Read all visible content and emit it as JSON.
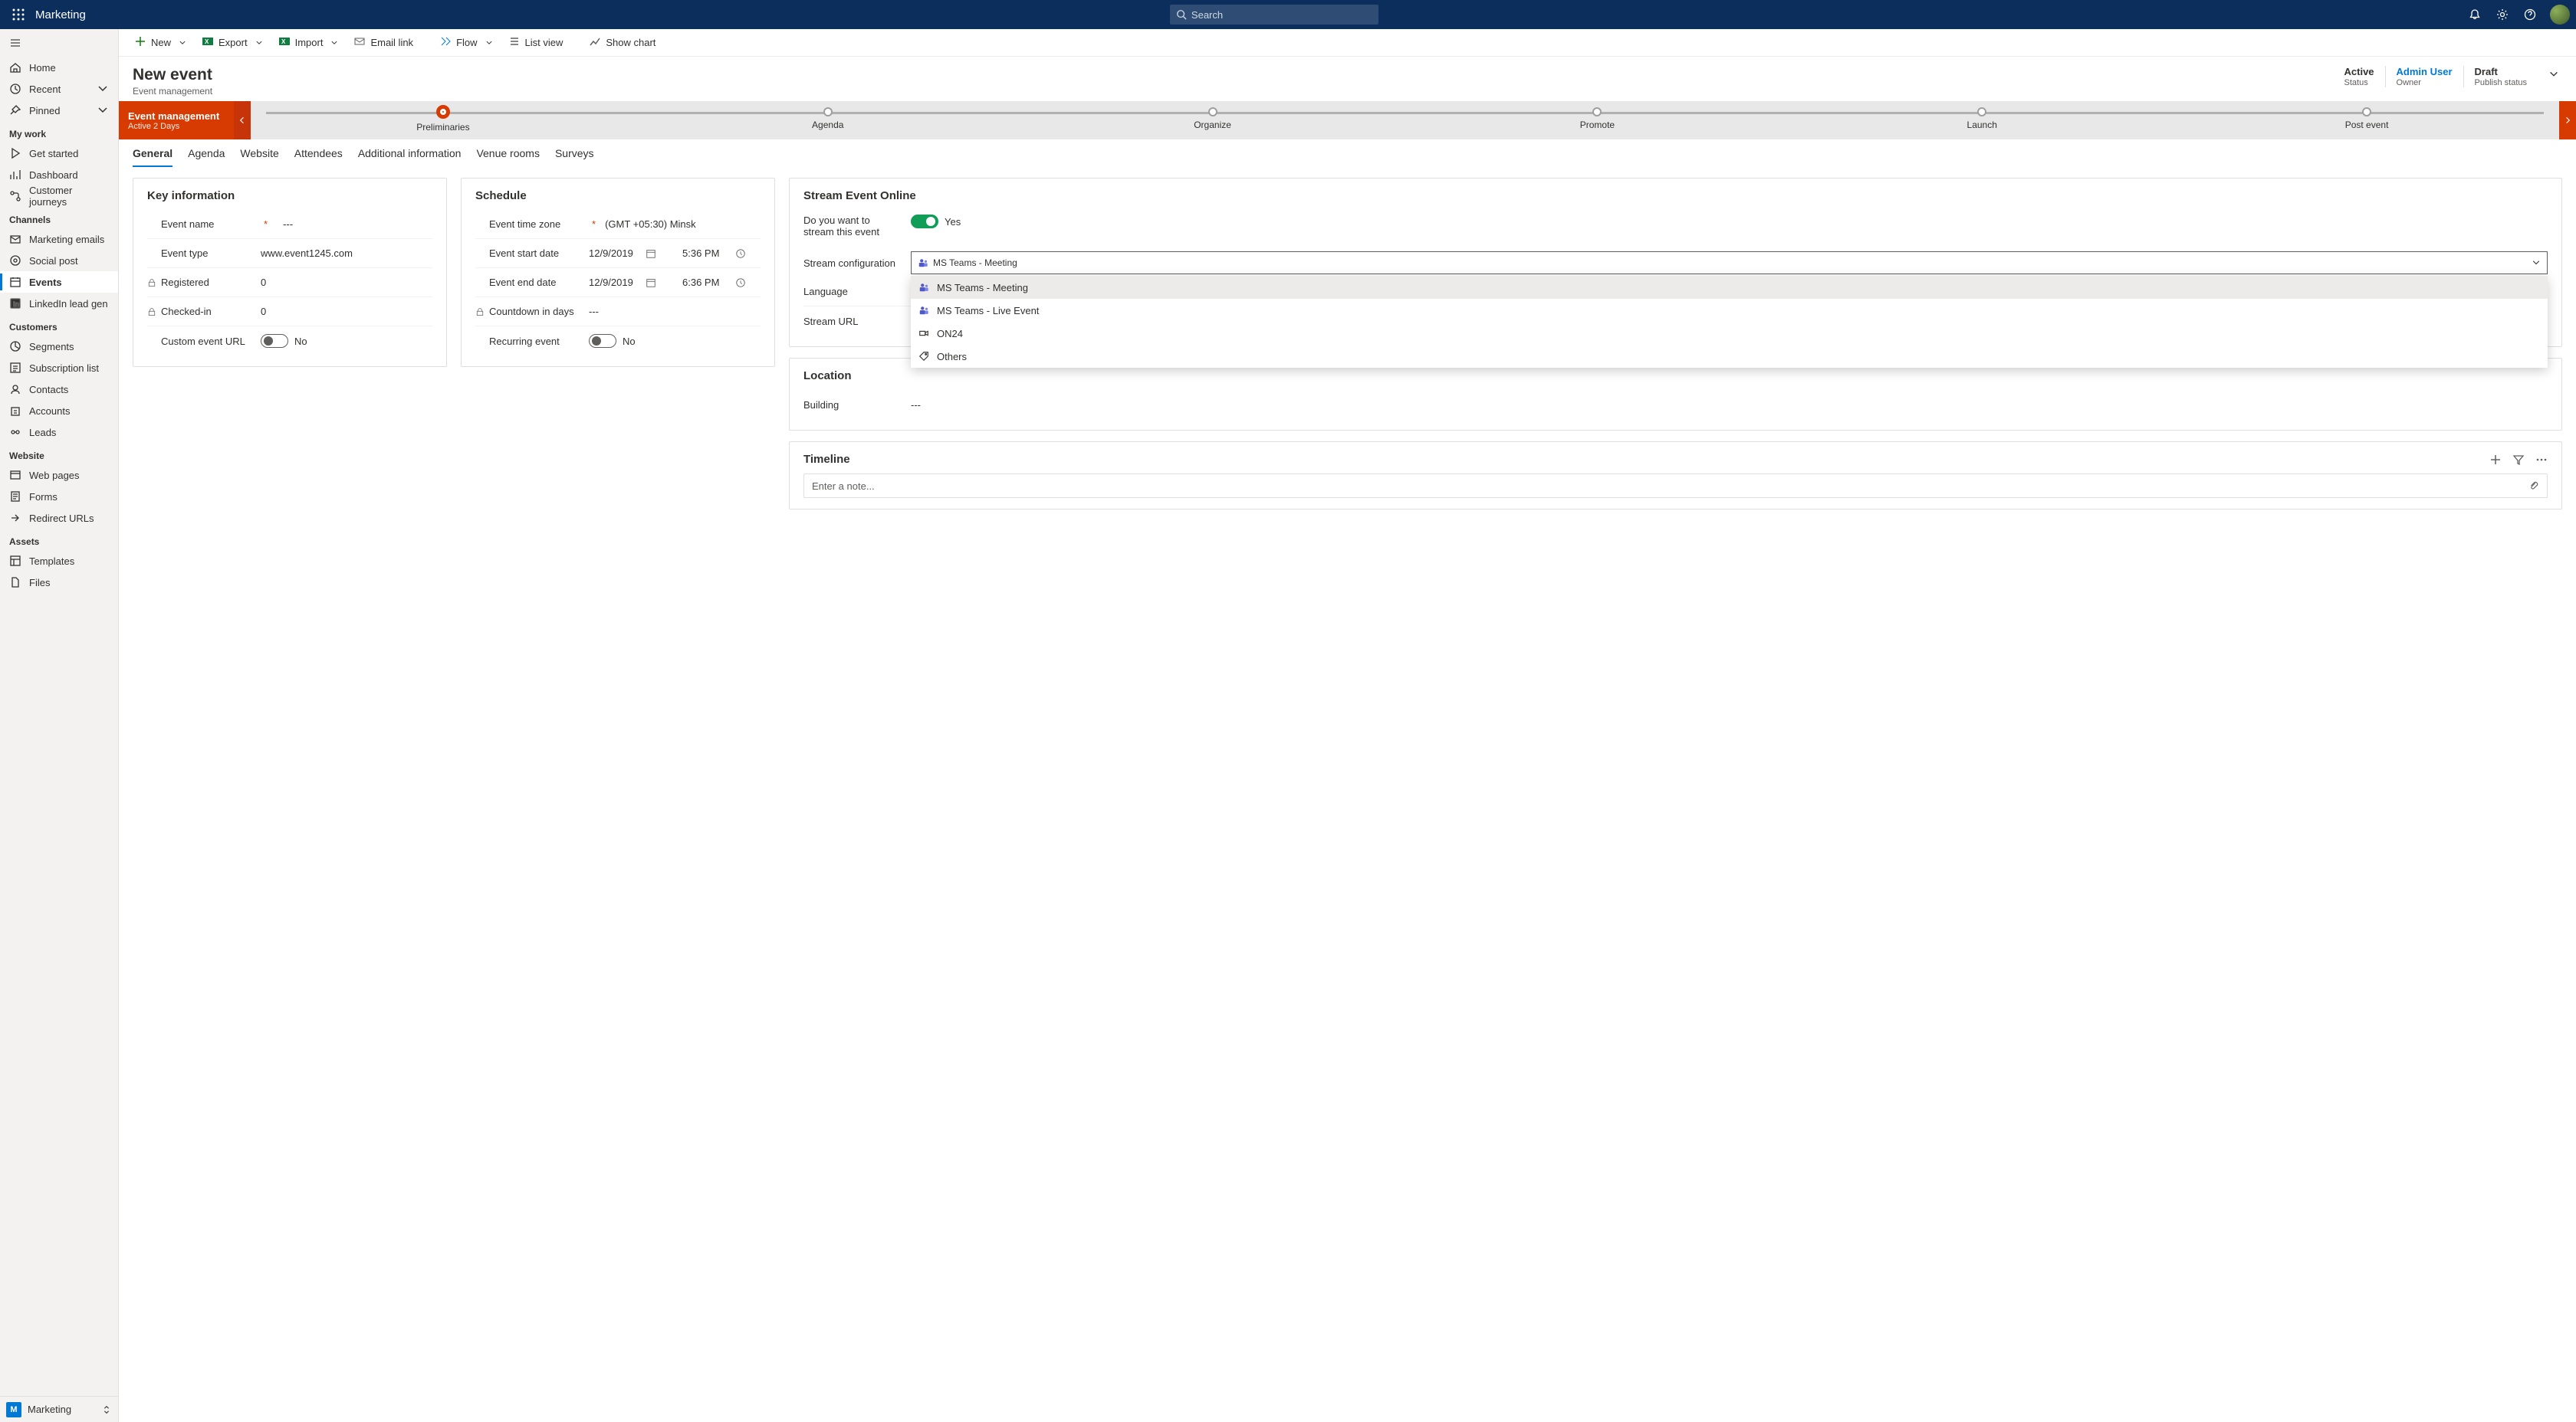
{
  "appName": "Marketing",
  "search": {
    "placeholder": "Search"
  },
  "sidebar": {
    "top": [
      {
        "label": "Home",
        "icon": "home"
      },
      {
        "label": "Recent",
        "icon": "clock",
        "chevron": true
      },
      {
        "label": "Pinned",
        "icon": "pin",
        "chevron": true
      }
    ],
    "groups": [
      {
        "title": "My work",
        "items": [
          {
            "label": "Get started",
            "icon": "play"
          },
          {
            "label": "Dashboard",
            "icon": "chart"
          },
          {
            "label": "Customer journeys",
            "icon": "journey"
          }
        ]
      },
      {
        "title": "Channels",
        "items": [
          {
            "label": "Marketing emails",
            "icon": "mail"
          },
          {
            "label": "Social post",
            "icon": "social"
          },
          {
            "label": "Events",
            "icon": "calendar",
            "active": true
          },
          {
            "label": "LinkedIn lead gen",
            "icon": "linkedin"
          }
        ]
      },
      {
        "title": "Customers",
        "items": [
          {
            "label": "Segments",
            "icon": "segments"
          },
          {
            "label": "Subscription list",
            "icon": "sublist"
          },
          {
            "label": "Contacts",
            "icon": "contact"
          },
          {
            "label": "Accounts",
            "icon": "accounts"
          },
          {
            "label": "Leads",
            "icon": "leads"
          }
        ]
      },
      {
        "title": "Website",
        "items": [
          {
            "label": "Web pages",
            "icon": "webpage"
          },
          {
            "label": "Forms",
            "icon": "forms"
          },
          {
            "label": "Redirect URLs",
            "icon": "redirect"
          }
        ]
      },
      {
        "title": "Assets",
        "items": [
          {
            "label": "Templates",
            "icon": "templates"
          },
          {
            "label": "Files",
            "icon": "files"
          }
        ]
      }
    ],
    "footer": {
      "badge": "M",
      "label": "Marketing"
    }
  },
  "commands": [
    {
      "label": "New",
      "icon": "plus",
      "split": true,
      "color": "#107c10"
    },
    {
      "label": "Export",
      "icon": "export",
      "split": true
    },
    {
      "label": "Import",
      "icon": "import",
      "split": true
    },
    {
      "label": "Email link",
      "icon": "emaillink"
    },
    {
      "label": "Flow",
      "icon": "flow",
      "split": true
    },
    {
      "label": "List view",
      "icon": "listview"
    },
    {
      "label": "Show chart",
      "icon": "showchart"
    }
  ],
  "page": {
    "title": "New event",
    "subtitle": "Event management",
    "headerFields": [
      {
        "value": "Active",
        "label": "Status"
      },
      {
        "value": "Admin User",
        "label": "Owner",
        "link": true
      },
      {
        "value": "Draft",
        "label": "Publish status"
      }
    ]
  },
  "process": {
    "currentTitle": "Event management",
    "currentSub": "Active 2 Days",
    "stages": [
      "Preliminaries",
      "Agenda",
      "Organize",
      "Promote",
      "Launch",
      "Post event"
    ],
    "activeIndex": 0
  },
  "tabs": [
    "General",
    "Agenda",
    "Website",
    "Attendees",
    "Additional information",
    "Venue rooms",
    "Surveys"
  ],
  "activeTab": 0,
  "keyInfo": {
    "title": "Key information",
    "fields": {
      "eventNameLabel": "Event name",
      "eventNameValue": "---",
      "eventTypeLabel": "Event type",
      "eventTypeValue": "www.event1245.com",
      "registeredLabel": "Registered",
      "registeredValue": "0",
      "checkedInLabel": "Checked-in",
      "checkedInValue": "0",
      "customUrlLabel": "Custom event URL",
      "customUrlValue": "No"
    }
  },
  "schedule": {
    "title": "Schedule",
    "fields": {
      "tzLabel": "Event time zone",
      "tzValue": "(GMT +05:30) Minsk",
      "startLabel": "Event start date",
      "startDate": "12/9/2019",
      "startTime": "5:36 PM",
      "endLabel": "Event end date",
      "endDate": "12/9/2019",
      "endTime": "6:36 PM",
      "countdownLabel": "Countdown in days",
      "countdownValue": "---",
      "recurringLabel": "Recurring event",
      "recurringValue": "No"
    }
  },
  "stream": {
    "title": "Stream Event Online",
    "questionText": "Do you want to stream this event",
    "questionValue": "Yes",
    "configLabel": "Stream configuration",
    "configSelected": "MS Teams - Meeting",
    "options": [
      {
        "label": "MS Teams - Meeting",
        "icon": "teams",
        "highlighted": true
      },
      {
        "label": "MS Teams - Live Event",
        "icon": "teams"
      },
      {
        "label": "ON24",
        "icon": "video"
      },
      {
        "label": "Others",
        "icon": "tag"
      }
    ],
    "langLabel": "Language",
    "urlLabel": "Stream URL"
  },
  "location": {
    "title": "Location",
    "buildingLabel": "Building",
    "buildingValue": "---"
  },
  "timeline": {
    "title": "Timeline",
    "placeholder": "Enter a note..."
  }
}
